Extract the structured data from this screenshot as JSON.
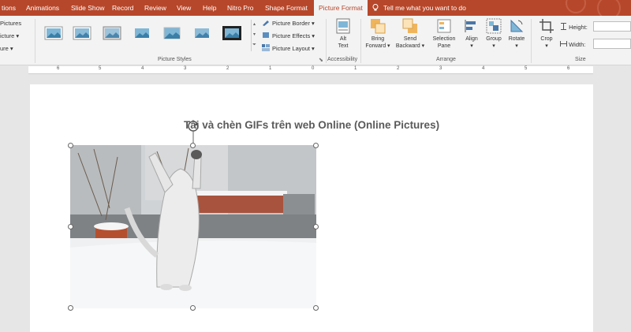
{
  "ribbon_tabs": {
    "tab_ations": "tions",
    "tab_animations": "Animations",
    "tab_slide_show": "Slide Show",
    "tab_record": "Record",
    "tab_review": "Review",
    "tab_view": "View",
    "tab_help": "Help",
    "tab_nitro": "Nitro Pro",
    "tab_shape_format": "Shape Format",
    "tab_picture_format": "Picture Format",
    "tell_me": "Tell me what you want to do"
  },
  "ribbon": {
    "left_items": [
      "Pictures",
      "icture",
      "ure"
    ],
    "picture_styles_label": "Picture Styles",
    "picture_border": "Picture Border",
    "picture_effects": "Picture Effects",
    "picture_layout": "Picture Layout",
    "alt_text_1": "Alt",
    "alt_text_2": "Text",
    "accessibility_label": "Accessibility",
    "bring_forward_1": "Bring",
    "bring_forward_2": "Forward",
    "send_backward_1": "Send",
    "send_backward_2": "Backward",
    "selection_pane_1": "Selection",
    "selection_pane_2": "Pane",
    "align": "Align",
    "group": "Group",
    "rotate": "Rotate",
    "arrange_label": "Arrange",
    "crop": "Crop",
    "height_label": "Height:",
    "width_label": "Width:",
    "size_label": "Size"
  },
  "ruler": {
    "numbers": [
      "6",
      "5",
      "4",
      "3",
      "2",
      "1",
      "0",
      "1",
      "2",
      "3",
      "4",
      "5",
      "6"
    ]
  },
  "slide": {
    "title": "Tải và chèn GIFs trên web Online (Online Pictures)"
  },
  "colors": {
    "accent": "#b7472a",
    "ribbon_bg": "#f3f3f3",
    "canvas_bg": "#e6e6e6"
  }
}
